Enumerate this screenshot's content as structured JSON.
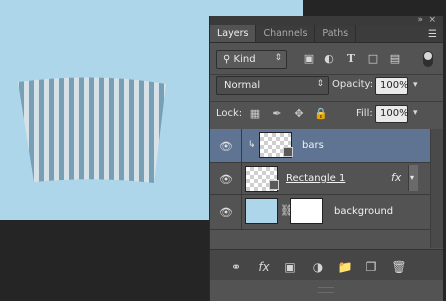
{
  "panel": {
    "collapse_icon": "double-chevron-right-icon",
    "close_icon": "close-icon",
    "tabs": [
      {
        "label": "Layers",
        "active": true
      },
      {
        "label": "Channels",
        "active": false
      },
      {
        "label": "Paths",
        "active": false
      }
    ],
    "menu_icon": "panel-menu-icon"
  },
  "filter": {
    "kind_label": "Kind",
    "icons": [
      "image-filter-icon",
      "adjustment-filter-icon",
      "type-filter-icon",
      "shape-filter-icon",
      "smart-object-filter-icon"
    ]
  },
  "blend": {
    "mode": "Normal",
    "opacity_label": "Opacity:",
    "opacity_value": "100%",
    "lock_label": "Lock:",
    "fill_label": "Fill:",
    "fill_value": "100%"
  },
  "layers": [
    {
      "name": "bars",
      "selected": true,
      "clipped": true,
      "thumb": "transparent"
    },
    {
      "name": "Rectangle 1",
      "selected": false,
      "has_fx": true,
      "fx_label": "fx",
      "thumb": "transparent"
    },
    {
      "name": "background",
      "selected": false,
      "has_mask": true,
      "thumb": "fill"
    }
  ],
  "footer_icons": [
    "link-layers-icon",
    "fx-icon",
    "add-mask-icon",
    "adjustment-layer-icon",
    "new-group-icon",
    "new-layer-icon",
    "trash-icon"
  ],
  "colors": {
    "canvas": "#add6eb",
    "stripe_dark": "#7ea7bf",
    "stripe_light": "#e9f2f6",
    "selection": "#5f7492"
  }
}
